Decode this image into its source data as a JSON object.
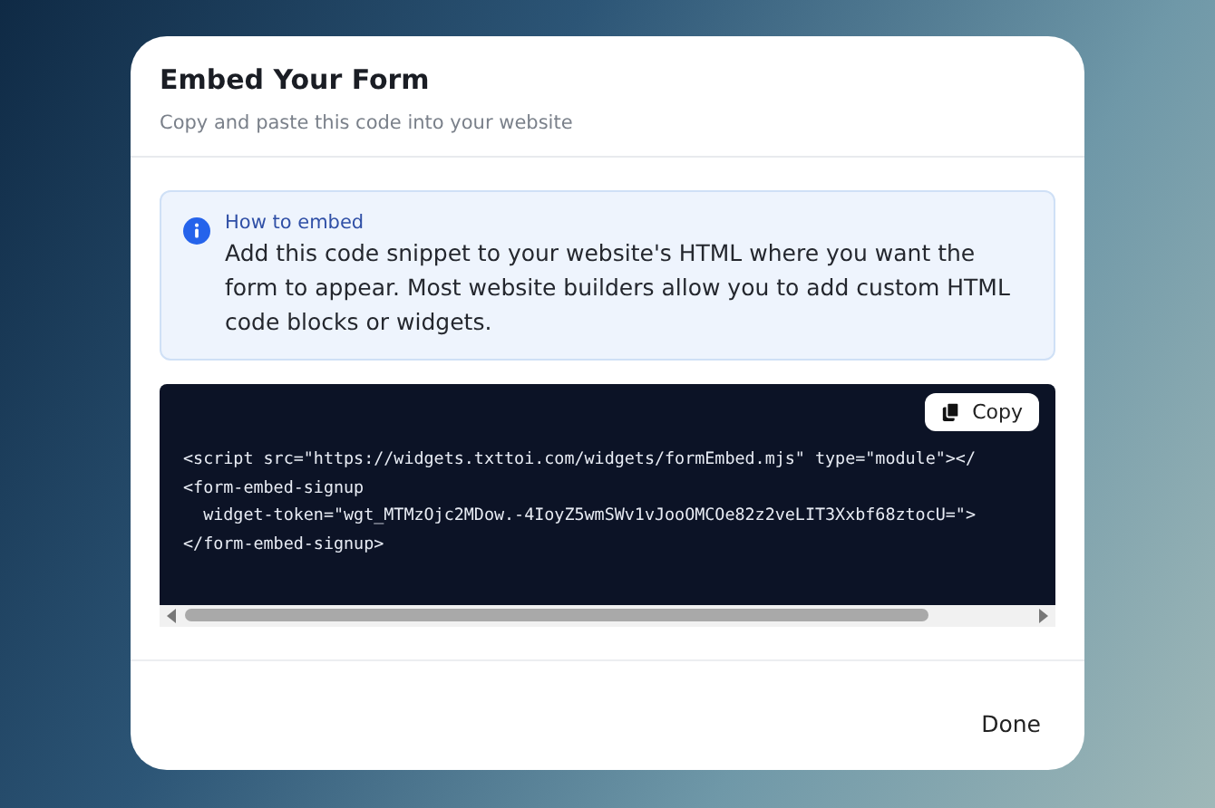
{
  "dialog": {
    "title": "Embed Your Form",
    "subtitle": "Copy and paste this code into your website"
  },
  "info": {
    "title": "How to embed",
    "text": "Add this code snippet to your website's HTML where you want the form to appear. Most website builders allow you to add custom HTML code blocks or widgets."
  },
  "code": {
    "copy_button": "Copy",
    "lines": [
      "<script src=\"https://widgets.txttoi.com/widgets/formEmbed.mjs\" type=\"module\"></",
      "<form-embed-signup",
      "  widget-token=\"wgt_MTMzOjc2MDow.-4IoyZ5wmSWv1vJooOMCOe82z2veLIT3Xxbf68ztocU=\">",
      "</form-embed-signup>"
    ]
  },
  "footer": {
    "button": "Done"
  }
}
